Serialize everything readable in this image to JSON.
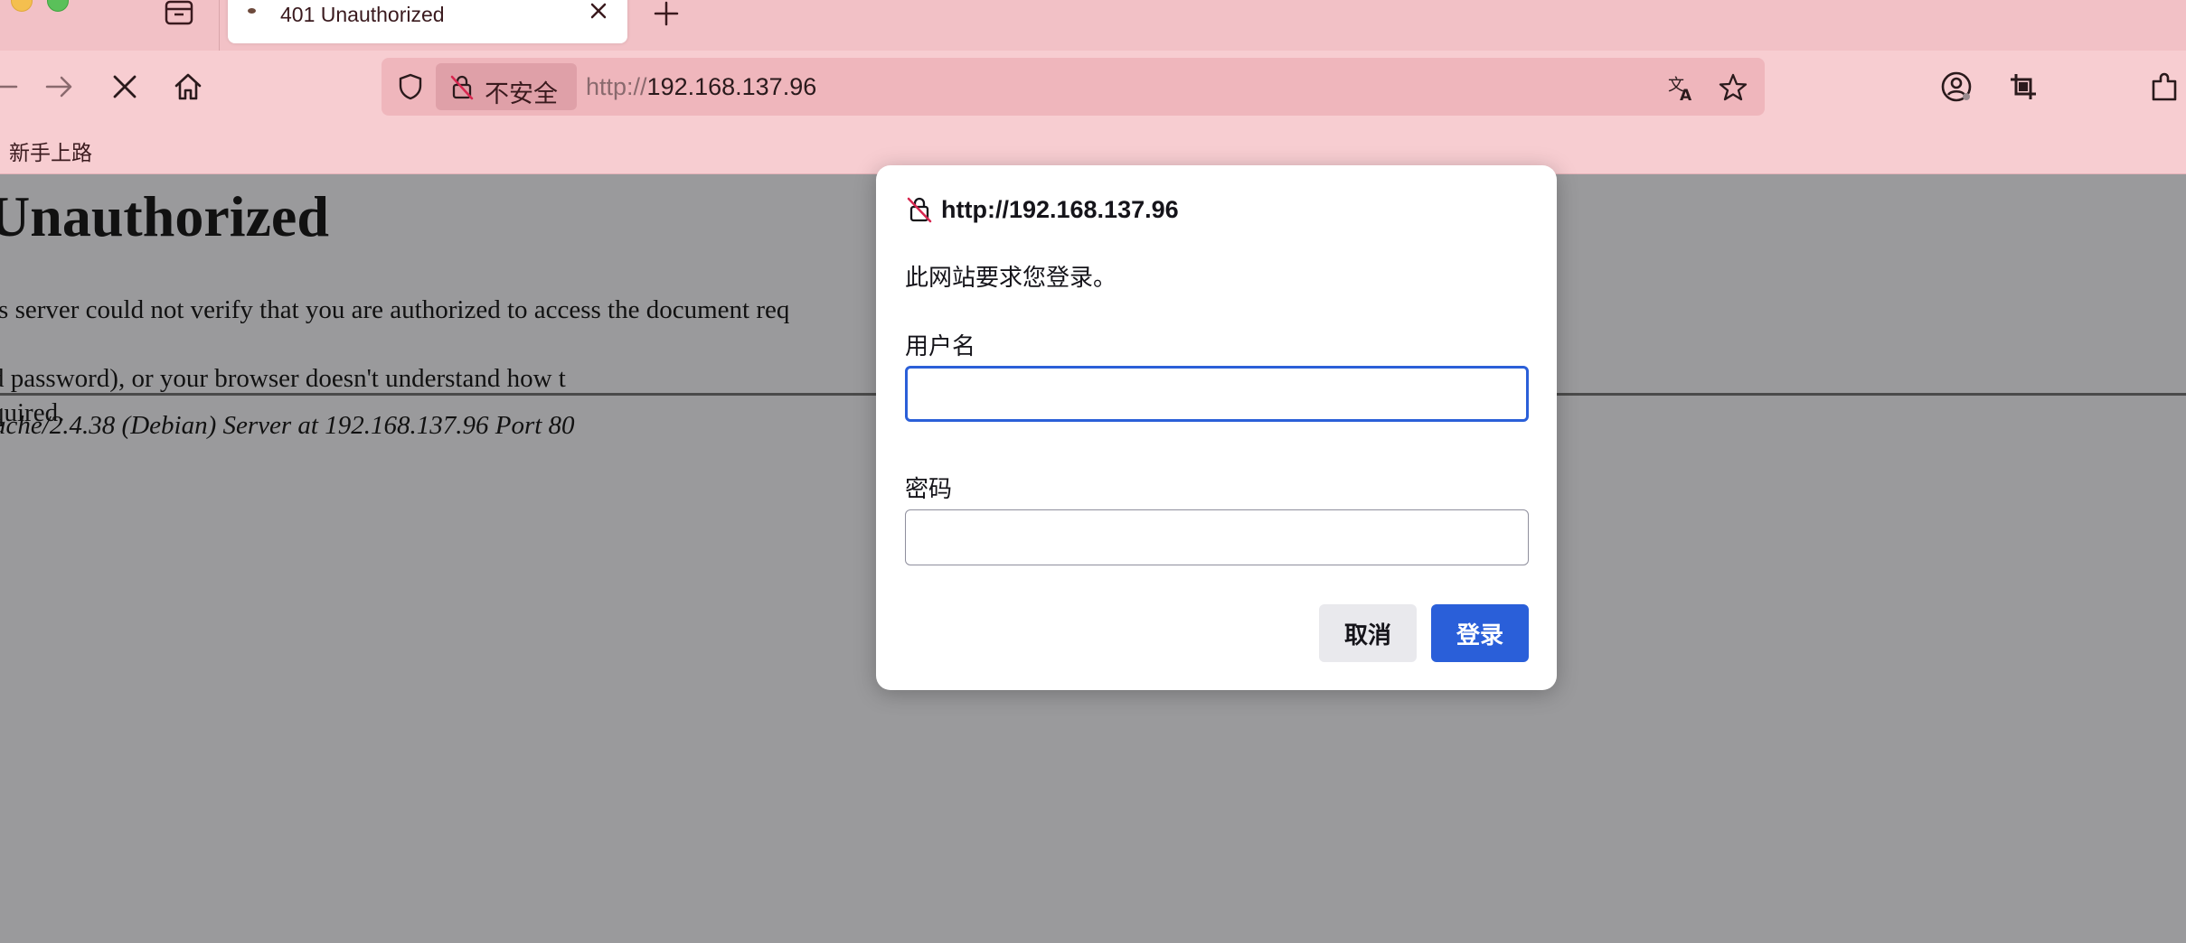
{
  "browser": {
    "tab": {
      "title": "401 Unauthorized"
    },
    "urlbar": {
      "security_label": "不安全",
      "url_scheme": "http://",
      "url_host": "192.168.137.96"
    },
    "bookmarks": [
      "新手上路"
    ]
  },
  "page": {
    "heading": "Unauthorized",
    "paragraph_line1": "is server could not verify that you are authorized to access the document req",
    "paragraph_line1_tail": "d password), or your browser doesn't understand how t",
    "paragraph_line2": "quired.",
    "address": "ache/2.4.38 (Debian) Server at 192.168.137.96 Port 80"
  },
  "dialog": {
    "origin": "http://192.168.137.96",
    "message": "此网站要求您登录。",
    "username_label": "用户名",
    "username_value": "",
    "password_label": "密码",
    "password_value": "",
    "cancel_label": "取消",
    "login_label": "登录"
  },
  "colors": {
    "chrome_tabstrip": "#f2c1c6",
    "chrome_toolbar": "#f7cdd1",
    "page_dimmed": "#9a9a9c",
    "primary_button": "#2a5fd9"
  }
}
